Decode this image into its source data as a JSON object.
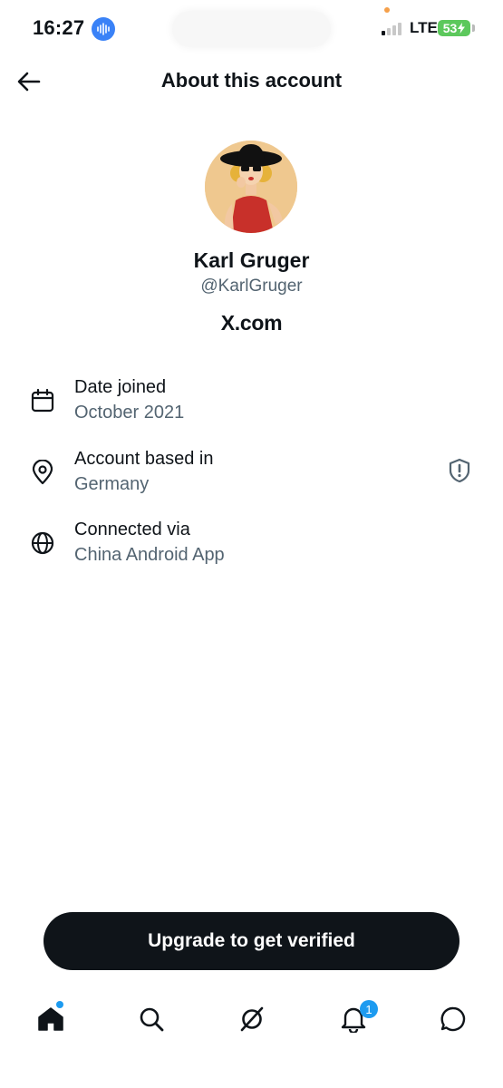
{
  "status_bar": {
    "time": "16:27",
    "network": "LTE",
    "battery": "53"
  },
  "header": {
    "title": "About this account"
  },
  "profile": {
    "display_name": "Karl Gruger",
    "handle": "@KarlGruger",
    "domain": "X.com"
  },
  "info_rows": [
    {
      "icon": "calendar-icon",
      "title": "Date joined",
      "value": "October 2021"
    },
    {
      "icon": "location-pin-icon",
      "title": "Account based in",
      "value": "Germany"
    },
    {
      "icon": "globe-icon",
      "title": "Connected via",
      "value": "China Android App"
    }
  ],
  "upgrade": {
    "label": "Upgrade to get verified"
  },
  "bottom_nav": {
    "items": [
      "home-icon",
      "search-icon",
      "grok-icon",
      "notifications-icon",
      "messages-icon"
    ],
    "notification_count": "1"
  },
  "colors": {
    "primary_text": "#0f1419",
    "secondary_text": "#536471",
    "accent": "#1d9bf0",
    "button_bg": "#0f1419"
  }
}
